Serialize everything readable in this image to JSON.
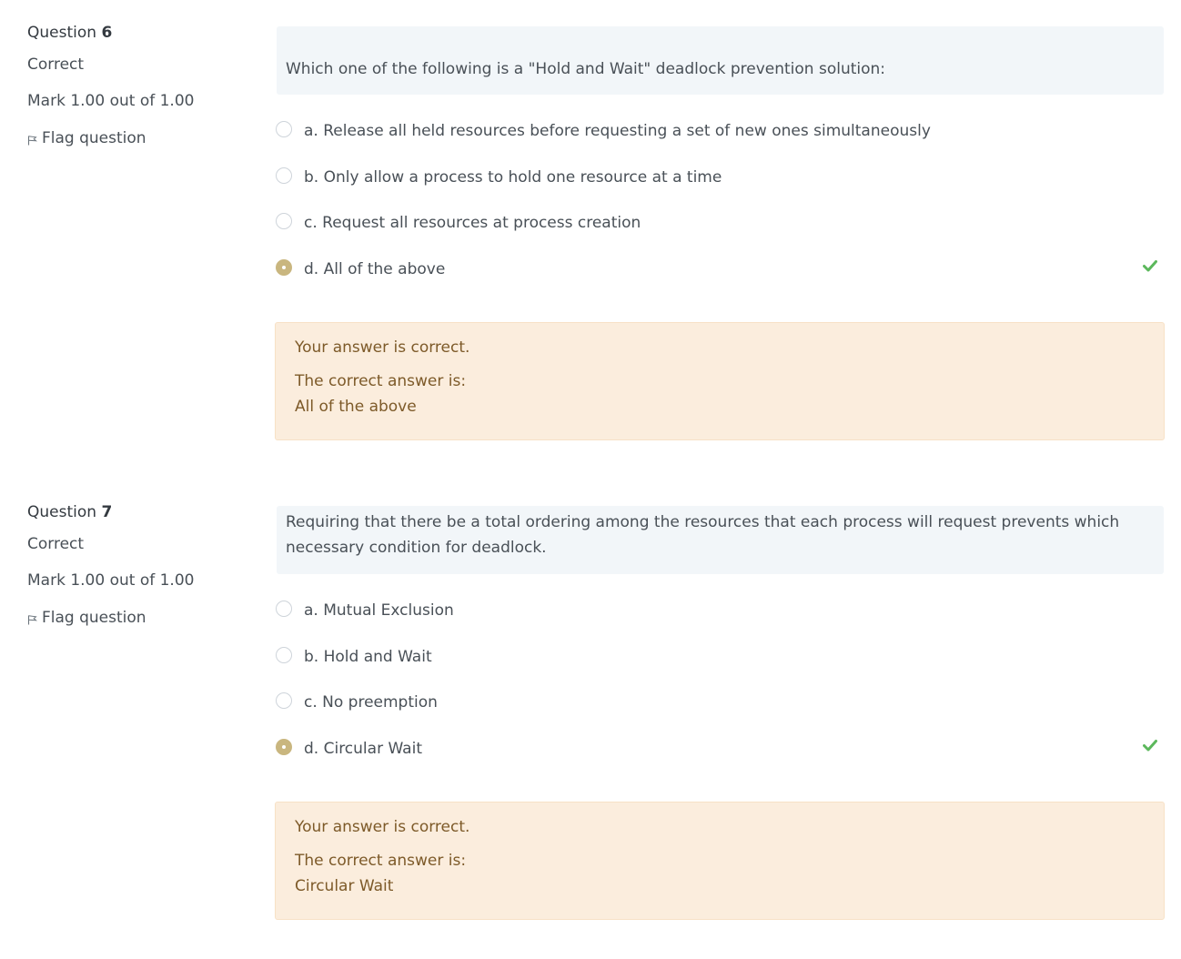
{
  "questions": [
    {
      "label": "Question",
      "number": "6",
      "state": "Correct",
      "grade": "Mark 1.00 out of 1.00",
      "flag_label": "Flag question",
      "text": "Which one of the following is a \"Hold and Wait\" deadlock prevention solution:",
      "options": [
        {
          "label": "a. Release all held resources before requesting a set of new ones simultaneously",
          "selected": false
        },
        {
          "label": "b. Only allow a process to hold one resource at a time",
          "selected": false
        },
        {
          "label": "c. Request all resources at process creation",
          "selected": false
        },
        {
          "label": "d. All of the above",
          "selected": true
        }
      ],
      "feedback": {
        "status": "Your answer is correct.",
        "right_answer_intro": "The correct answer is:",
        "right_answer": "All of the above"
      }
    },
    {
      "label": "Question",
      "number": "7",
      "state": "Correct",
      "grade": "Mark 1.00 out of 1.00",
      "flag_label": "Flag question",
      "text": "Requiring that there be a total ordering among the resources that each process will request prevents which necessary condition for deadlock.",
      "options": [
        {
          "label": "a. Mutual Exclusion",
          "selected": false
        },
        {
          "label": "b. Hold and Wait",
          "selected": false
        },
        {
          "label": "c. No preemption",
          "selected": false
        },
        {
          "label": "d. Circular Wait",
          "selected": true
        }
      ],
      "feedback": {
        "status": "Your answer is correct.",
        "right_answer_intro": "The correct answer is:",
        "right_answer": "Circular Wait"
      }
    }
  ],
  "icons": {
    "flag": "flag-icon",
    "correct": "check-icon"
  },
  "colors": {
    "accent_selected": "#c9b67f",
    "correct_check": "#5cb85c",
    "feedback_bg": "#fbeddd",
    "feedback_text": "#7d5a29",
    "question_text_bg": "#f2f6f9"
  }
}
